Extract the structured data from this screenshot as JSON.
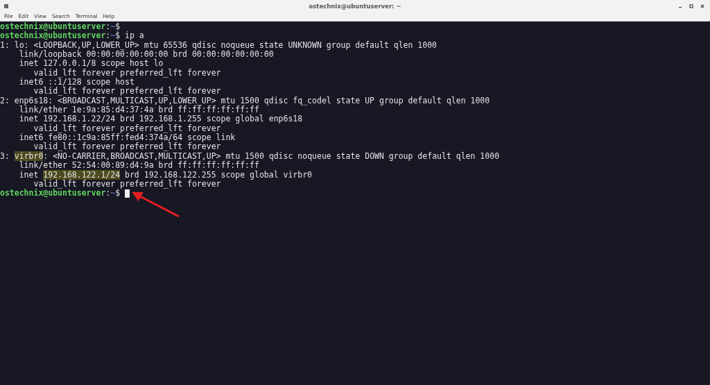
{
  "window": {
    "title": "ostechnix@ubuntuserver: ~"
  },
  "menu": [
    {
      "label": "File"
    },
    {
      "label": "Edit"
    },
    {
      "label": "View"
    },
    {
      "label": "Search"
    },
    {
      "label": "Terminal"
    },
    {
      "label": "Help"
    }
  ],
  "terminal": {
    "lines": [
      {
        "segments": [
          {
            "kind": "user",
            "text": "ostechnix@ubuntuserver"
          },
          {
            "kind": "plain",
            "text": ":"
          },
          {
            "kind": "path",
            "text": "~"
          },
          {
            "kind": "plain",
            "text": "$"
          }
        ]
      },
      {
        "segments": [
          {
            "kind": "user",
            "text": "ostechnix@ubuntuserver"
          },
          {
            "kind": "plain",
            "text": ":"
          },
          {
            "kind": "path",
            "text": "~"
          },
          {
            "kind": "plain",
            "text": "$ ip a"
          }
        ]
      },
      {
        "segments": [
          {
            "kind": "plain",
            "text": "1: lo: <LOOPBACK,UP,LOWER_UP> mtu 65536 qdisc noqueue state UNKNOWN group default qlen 1000"
          }
        ]
      },
      {
        "segments": [
          {
            "kind": "plain",
            "text": "    link/loopback 00:00:00:00:00:00 brd 00:00:00:00:00:00"
          }
        ]
      },
      {
        "segments": [
          {
            "kind": "plain",
            "text": "    inet 127.0.0.1/8 scope host lo"
          }
        ]
      },
      {
        "segments": [
          {
            "kind": "plain",
            "text": "       valid_lft forever preferred_lft forever"
          }
        ]
      },
      {
        "segments": [
          {
            "kind": "plain",
            "text": "    inet6 ::1/128 scope host"
          }
        ]
      },
      {
        "segments": [
          {
            "kind": "plain",
            "text": "       valid_lft forever preferred_lft forever"
          }
        ]
      },
      {
        "segments": [
          {
            "kind": "plain",
            "text": "2: enp6s18: <BROADCAST,MULTICAST,UP,LOWER_UP> mtu 1500 qdisc fq_codel state UP group default qlen 1000"
          }
        ]
      },
      {
        "segments": [
          {
            "kind": "plain",
            "text": "    link/ether 1e:9a:85:d4:37:4a brd ff:ff:ff:ff:ff:ff"
          }
        ]
      },
      {
        "segments": [
          {
            "kind": "plain",
            "text": "    inet 192.168.1.22/24 brd 192.168.1.255 scope global enp6s18"
          }
        ]
      },
      {
        "segments": [
          {
            "kind": "plain",
            "text": "       valid_lft forever preferred_lft forever"
          }
        ]
      },
      {
        "segments": [
          {
            "kind": "plain",
            "text": "    inet6 fe80::1c9a:85ff:fed4:374a/64 scope link"
          }
        ]
      },
      {
        "segments": [
          {
            "kind": "plain",
            "text": "       valid_lft forever preferred_lft forever"
          }
        ]
      },
      {
        "segments": [
          {
            "kind": "plain",
            "text": "3: "
          },
          {
            "kind": "highlight",
            "text": "virbr0"
          },
          {
            "kind": "plain",
            "text": ": <NO-CARRIER,BROADCAST,MULTICAST,UP> mtu 1500 qdisc noqueue state DOWN group default qlen 1000"
          }
        ]
      },
      {
        "segments": [
          {
            "kind": "plain",
            "text": "    link/ether 52:54:00:89:d4:9a brd ff:ff:ff:ff:ff:ff"
          }
        ]
      },
      {
        "segments": [
          {
            "kind": "plain",
            "text": "    inet "
          },
          {
            "kind": "highlight",
            "text": "192.168.122.1/24"
          },
          {
            "kind": "plain",
            "text": " brd 192.168.122.255 scope global virbr0"
          }
        ]
      },
      {
        "segments": [
          {
            "kind": "plain",
            "text": "       valid_lft forever preferred_lft forever"
          }
        ]
      },
      {
        "segments": [
          {
            "kind": "user",
            "text": "ostechnix@ubuntuserver"
          },
          {
            "kind": "plain",
            "text": ":"
          },
          {
            "kind": "path",
            "text": "~"
          },
          {
            "kind": "plain",
            "text": "$ "
          }
        ],
        "cursor": true
      }
    ]
  }
}
